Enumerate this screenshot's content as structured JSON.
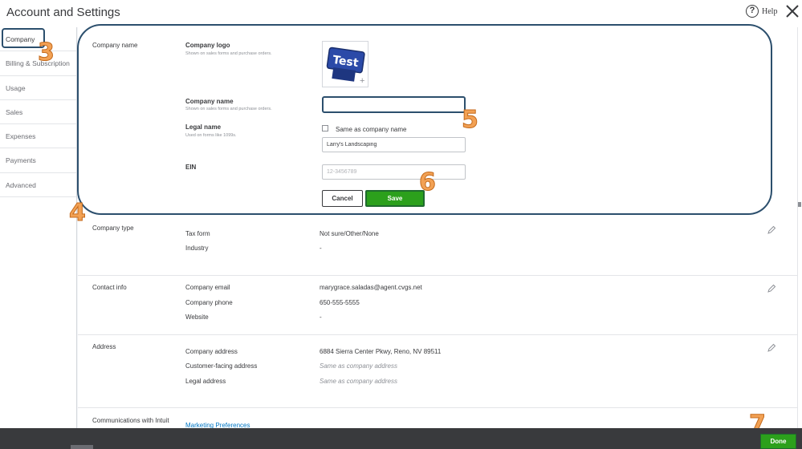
{
  "header": {
    "title": "Account and Settings",
    "help_label": "Help"
  },
  "sidebar": {
    "items": [
      {
        "label": "Company"
      },
      {
        "label": "Billing & Subscription"
      },
      {
        "label": "Usage"
      },
      {
        "label": "Sales"
      },
      {
        "label": "Expenses"
      },
      {
        "label": "Payments"
      },
      {
        "label": "Advanced"
      }
    ]
  },
  "company_name_section": {
    "title": "Company name",
    "logo_label": "Company logo",
    "logo_hint": "Shown on sales forms and purchase orders.",
    "logo_text": "Test",
    "name_label": "Company name",
    "name_hint": "Shown on sales forms and purchase orders.",
    "name_value": "",
    "legal_label": "Legal name",
    "legal_hint": "Used on forms like 1099s.",
    "same_as_label": "Same as company name",
    "legal_value": "Larry's Landscaping",
    "ein_label": "EIN",
    "ein_placeholder": "12-3456789",
    "cancel_label": "Cancel",
    "save_label": "Save"
  },
  "company_type": {
    "title": "Company type",
    "rows": [
      {
        "label": "Tax form",
        "value": "Not sure/Other/None"
      },
      {
        "label": "Industry",
        "value": "-"
      }
    ]
  },
  "contact_info": {
    "title": "Contact info",
    "rows": [
      {
        "label": "Company email",
        "value": "marygrace.saladas@agent.cvgs.net"
      },
      {
        "label": "Company phone",
        "value": "650-555-5555"
      },
      {
        "label": "Website",
        "value": "-"
      }
    ]
  },
  "address": {
    "title": "Address",
    "rows": [
      {
        "label": "Company address",
        "value": "6884 Sierra Center Pkwy, Reno, NV 89511"
      },
      {
        "label": "Customer-facing address",
        "value": "Same as company address"
      },
      {
        "label": "Legal address",
        "value": "Same as company address"
      }
    ]
  },
  "communications": {
    "title": "Communications with Intuit",
    "link": "Marketing Preferences"
  },
  "annotations": [
    "3",
    "4",
    "5",
    "6",
    "7"
  ],
  "footer": {
    "done_label": "Done"
  },
  "colors": {
    "accent_green": "#2ca01c",
    "link_blue": "#0077c5",
    "callout_orange": "#f2a154",
    "highlight_navy": "#2c4f6d"
  }
}
